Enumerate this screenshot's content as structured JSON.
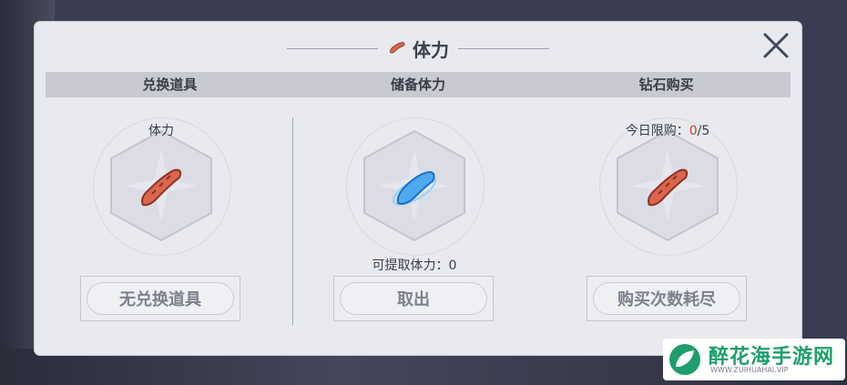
{
  "window": {
    "title": "体力"
  },
  "columns": [
    {
      "header": "兑换道具",
      "top_label": "体力",
      "button": "无兑换道具",
      "item": "sausage-icon"
    },
    {
      "header": "储备体力",
      "mid_label": "可提取体力：0",
      "button": "取出",
      "item": "blue-crystal-icon"
    },
    {
      "header": "钻石购买",
      "limit_label": "今日限购：",
      "limit_current": "0",
      "limit_total": "/5",
      "button": "购买次数耗尽",
      "item": "sausage-icon"
    }
  ],
  "watermark": {
    "text": "醉花海手游网",
    "sub": "WWW.ZUIHUAHAI.VIP"
  },
  "colors": {
    "panel": "#e9eaef",
    "header_bar": "#c9cad1",
    "accent_red": "#c9402f",
    "watermark_green": "#1e9e6a"
  }
}
